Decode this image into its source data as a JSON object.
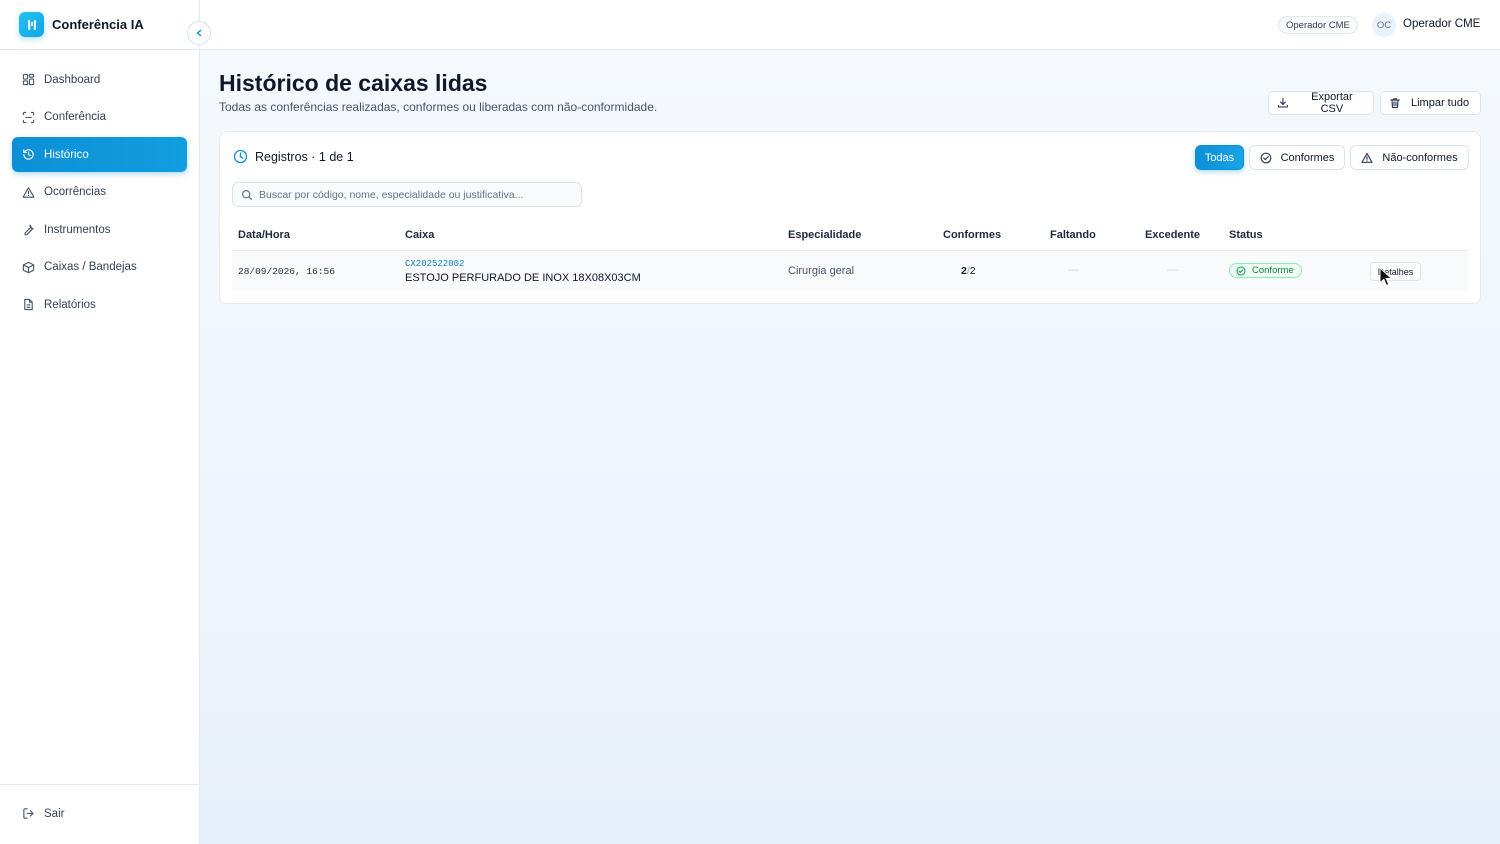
{
  "app": {
    "name": "Conferência IA"
  },
  "colors": {
    "accent": "#0c8fd6",
    "success": "#16a34a",
    "muted": "#64748b"
  },
  "sidebar": {
    "items": [
      {
        "label": "Dashboard",
        "icon": "grid-icon"
      },
      {
        "label": "Conferência",
        "icon": "scan-icon"
      },
      {
        "label": "Histórico",
        "icon": "history-icon",
        "active": true
      },
      {
        "label": "Ocorrências",
        "icon": "warning-icon"
      },
      {
        "label": "Instrumentos",
        "icon": "wrench-icon"
      },
      {
        "label": "Caixas / Bandejas",
        "icon": "box-icon"
      },
      {
        "label": "Relatórios",
        "icon": "document-icon"
      }
    ],
    "logout_label": "Sair"
  },
  "topbar": {
    "role_badge": "Operador CME",
    "avatar_initials": "OC",
    "user_name": "Operador CME"
  },
  "page": {
    "title": "Histórico de caixas lidas",
    "subtitle": "Todas as conferências realizadas, conformes ou liberadas com não-conformidade.",
    "export_label": "Exportar CSV",
    "clear_label": "Limpar tudo"
  },
  "records": {
    "title": "Registros · 1 de 1",
    "filters": {
      "all": "Todas",
      "compliant": "Conformes",
      "noncompliant": "Não-conformes"
    },
    "search_placeholder": "Buscar por código, nome, especialidade ou justificativa...",
    "columns": {
      "datetime": "Data/Hora",
      "box": "Caixa",
      "specialty": "Especialidade",
      "compliant": "Conformes",
      "missing": "Faltando",
      "excess": "Excedente",
      "status": "Status"
    },
    "rows": [
      {
        "datetime": "28/09/2026, 16:56",
        "code": "CX202522002",
        "name": "ESTOJO PERFURADO DE INOX 18X08X03CM",
        "specialty": "Cirurgia geral",
        "compliant_count": "2",
        "compliant_sep": "/",
        "compliant_total": "2",
        "missing": "—",
        "excess": "—",
        "status": "Conforme",
        "details_label": "Detalhes"
      }
    ]
  }
}
